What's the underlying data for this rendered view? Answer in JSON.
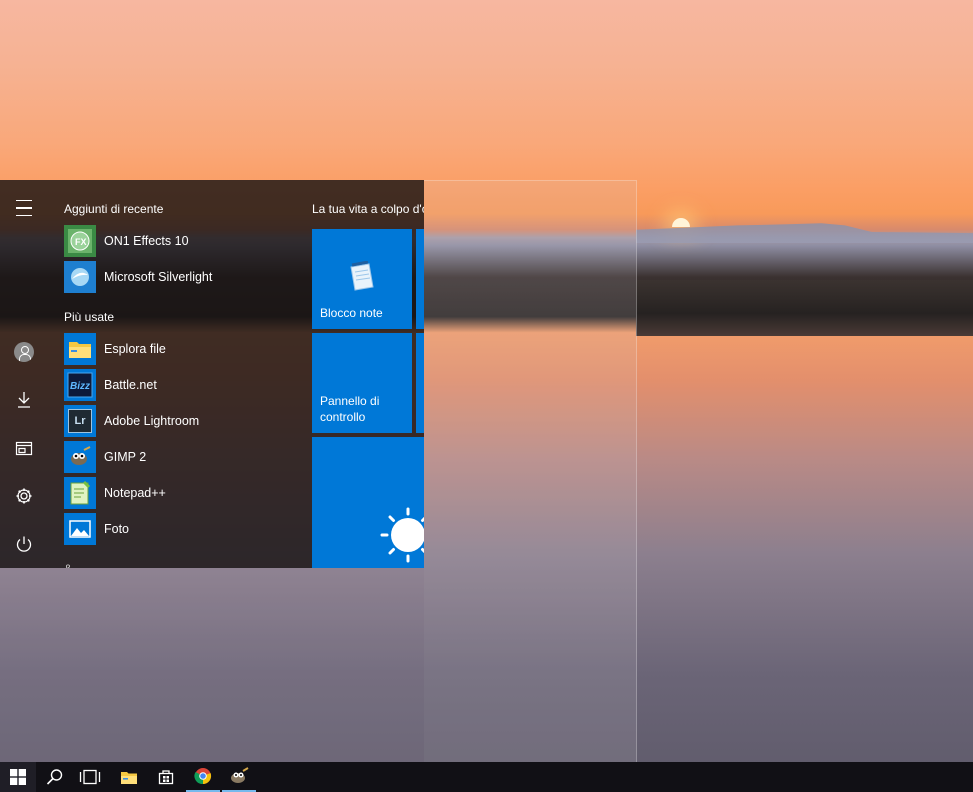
{
  "start_menu": {
    "recent_header": "Aggiunti di recente",
    "recent_apps": [
      {
        "label": "ON1 Effects 10",
        "icon": "on1-effects-icon"
      },
      {
        "label": "Microsoft Silverlight",
        "icon": "silverlight-icon"
      }
    ],
    "most_used_header": "Più usate",
    "most_used_apps": [
      {
        "label": "Esplora file",
        "icon": "folder-icon"
      },
      {
        "label": "Battle.net",
        "icon": "battlenet-icon"
      },
      {
        "label": "Adobe Lightroom",
        "icon": "lightroom-icon"
      },
      {
        "label": "GIMP 2",
        "icon": "gimp-icon"
      },
      {
        "label": "Notepad++",
        "icon": "notepadpp-icon"
      },
      {
        "label": "Foto",
        "icon": "photos-icon"
      }
    ],
    "next_group_label": "&",
    "lightroom_icon_text": "Lr",
    "tiles_header": "La tua vita a colpo d'occhio",
    "tiles": {
      "notepad": "Blocco note",
      "control_panel": "Pannello di controllo"
    }
  },
  "colors": {
    "tile_blue": "#0078d7",
    "taskbar": "#111015",
    "active_indicator": "#76b9ed"
  }
}
